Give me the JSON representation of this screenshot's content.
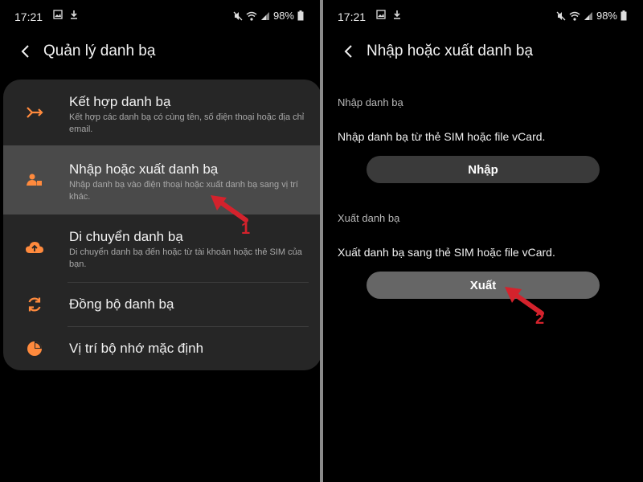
{
  "status": {
    "time": "17:21",
    "battery": "98%"
  },
  "left": {
    "title": "Quản lý danh bạ",
    "items": [
      {
        "title": "Kết hợp danh bạ",
        "desc": "Kết hợp các danh bạ có cùng tên, số điện thoại hoặc địa chỉ email.",
        "icon": "merge-icon"
      },
      {
        "title": "Nhập hoặc xuất danh bạ",
        "desc": "Nhập danh bạ vào điện thoại hoặc xuất danh bạ sang vị trí khác.",
        "icon": "contact-import-icon"
      },
      {
        "title": "Di chuyển danh bạ",
        "desc": "Di chuyển danh bạ đến hoặc từ tài khoản hoặc thẻ SIM của bạn.",
        "icon": "cloud-upload-icon"
      },
      {
        "title": "Đồng bộ danh bạ",
        "icon": "sync-icon"
      },
      {
        "title": "Vị trí bộ nhớ mặc định",
        "icon": "storage-pie-icon"
      }
    ]
  },
  "right": {
    "title": "Nhập hoặc xuất danh bạ",
    "import_section": {
      "label": "Nhập danh bạ",
      "text": "Nhập danh bạ từ thẻ SIM hoặc file vCard.",
      "button": "Nhập"
    },
    "export_section": {
      "label": "Xuất danh bạ",
      "text": "Xuất danh bạ sang thẻ SIM hoặc file vCard.",
      "button": "Xuất"
    }
  },
  "annotations": {
    "step1": "1",
    "step2": "2"
  },
  "colors": {
    "accent": "#ff8a3d",
    "annotation": "#d4222c",
    "card": "#262626",
    "highlight": "#4a4a4a"
  }
}
